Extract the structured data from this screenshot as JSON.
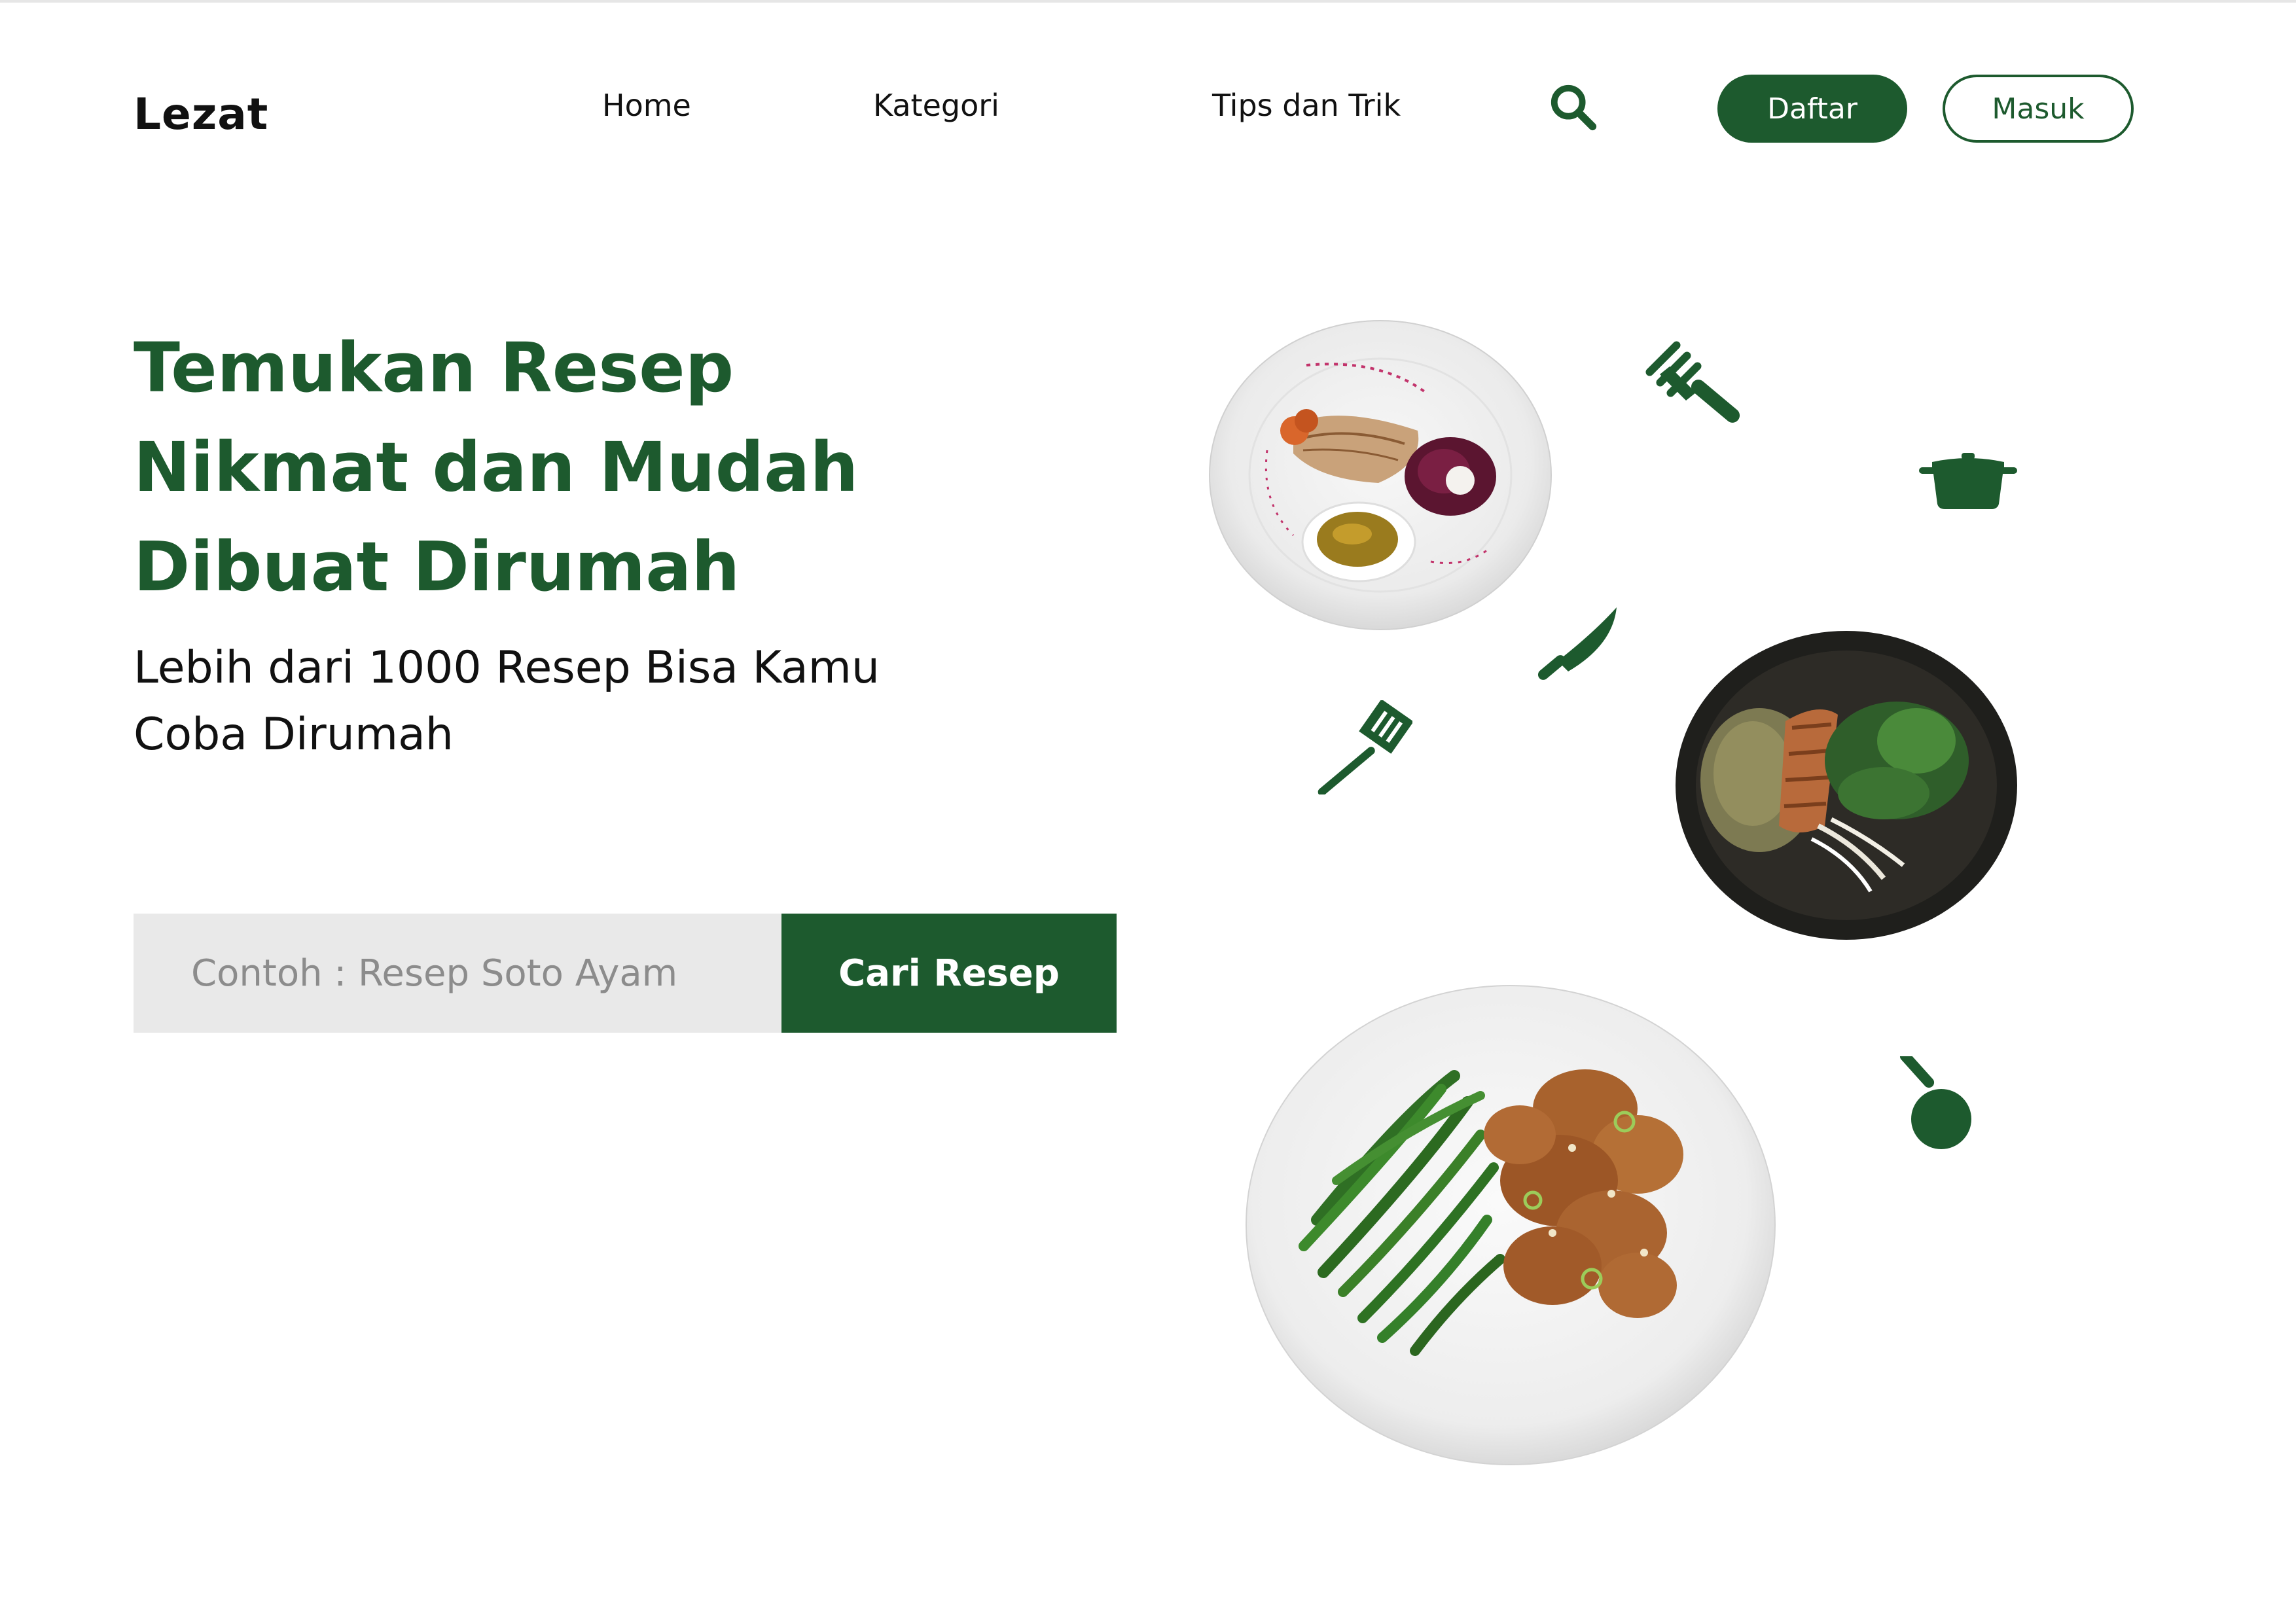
{
  "brand": {
    "name": "Lezat",
    "primary_color": "#1d5a2e"
  },
  "nav": {
    "items": [
      {
        "label": "Home"
      },
      {
        "label": "Kategori"
      },
      {
        "label": "Tips dan Trik"
      }
    ],
    "search_icon": "search-icon"
  },
  "auth": {
    "register_label": "Daftar",
    "login_label": "Masuk"
  },
  "hero": {
    "title_lines": [
      "Temukan Resep",
      "Nikmat dan Mudah",
      "Dibuat Dirumah"
    ],
    "subtitle_lines": [
      "Lebih dari 1000 Resep Bisa Kamu",
      "Coba Dirumah"
    ]
  },
  "search": {
    "placeholder": "Contoh : Resep Soto Ayam",
    "value": "",
    "button_label": "Cari Resep"
  },
  "decorations": {
    "food_images": [
      "plated-fish-dish",
      "chicken-salad-bowl",
      "green-beans-chicken-plate"
    ],
    "icons": [
      "fork-icon",
      "cooking-pot-icon",
      "knife-icon",
      "spatula-icon",
      "frying-pan-icon"
    ]
  }
}
